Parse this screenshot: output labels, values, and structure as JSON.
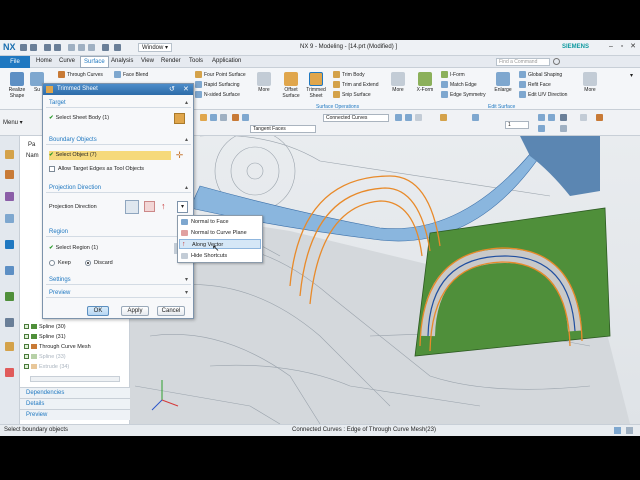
{
  "app": {
    "logo": "NX",
    "window_menu": "Window",
    "title": "NX 9 - Modeling - [14.prt (Modified) ]",
    "brand": "SIEMENS"
  },
  "menubar": {
    "file": "File",
    "items": [
      "Home",
      "Curve",
      "Surface",
      "Analysis",
      "View",
      "Render",
      "Tools",
      "Application"
    ],
    "active": "Surface",
    "search_placeholder": "Find a Command"
  },
  "ribbon": {
    "realize_shape": "Realize\nShape",
    "surface_short": "Su",
    "through_curves": "Through Curves",
    "face_blend": "Face Blend",
    "four_point": "Four Point Surface",
    "rapid": "Rapid Surfacing",
    "n_sided": "N-sided Surface",
    "more1": "More",
    "offset_surface": "Offset Surface",
    "trimmed_sheet": "Trimmed Sheet",
    "trim_body": "Trim Body",
    "trim_extend": "Trim and Extend",
    "snip_surface": "Snip Surface",
    "more2": "More",
    "surface_ops": "Surface Operations",
    "x_form": "X-Form",
    "i_form": "I-Form",
    "match_edge": "Match Edge",
    "edge_symmetry": "Edge Symmetry",
    "enlarge": "Enlarge",
    "global_shaping": "Global Shaping",
    "refit_face": "Refit Face",
    "edit_uv": "Edit U/V Direction",
    "more3": "More",
    "edit_surface": "Edit Surface"
  },
  "toolbar2": {
    "menu": "Menu",
    "tangent_faces": "Tangent Faces",
    "connected_curves": "Connected Curves",
    "step_value": "1"
  },
  "navigator": {
    "tab": "Pa",
    "col_name": "Nam",
    "items": [
      {
        "label": "Spline (30)",
        "dim": false
      },
      {
        "label": "Spline (31)",
        "dim": false
      },
      {
        "label": "Through Curve Mesh",
        "dim": false
      },
      {
        "label": "Spline (33)",
        "dim": true
      },
      {
        "label": "Extrude (34)",
        "dim": true
      }
    ],
    "dependencies": "Dependencies",
    "details": "Details",
    "preview": "Preview"
  },
  "dialog": {
    "title": "Trimmed Sheet",
    "target_hdr": "Target",
    "select_sheet_body": "Select Sheet Body (1)",
    "boundary_hdr": "Boundary Objects",
    "select_object": "Select Object (7)",
    "allow_target_edges": "Allow Target Edges as Tool Objects",
    "projection_hdr": "Projection Direction",
    "projection_label": "Projection Direction",
    "region_hdr": "Region",
    "select_region": "Select Region (1)",
    "keep": "Keep",
    "discard": "Discard",
    "region_choice": "Discard",
    "settings_hdr": "Settings",
    "preview_hdr": "Preview",
    "ok": "OK",
    "apply": "Apply",
    "cancel": "Cancel"
  },
  "dropdown": {
    "items": [
      "Normal to Face",
      "Normal to Curve Plane",
      "Along Vector",
      "Hide Shortcuts"
    ],
    "highlighted": "Along Vector"
  },
  "statusbar": {
    "left": "Select boundary objects",
    "right": "Connected Curves : Edge of Through Curve Mesh(23)"
  },
  "colors": {
    "accent": "#1f78c1",
    "title_bar": "#2d6ba8",
    "selection": "#f6d97b",
    "green_sheet": "#4f8f3a",
    "curves": "#e88a2a",
    "blue_surface": "#8ab6de"
  }
}
